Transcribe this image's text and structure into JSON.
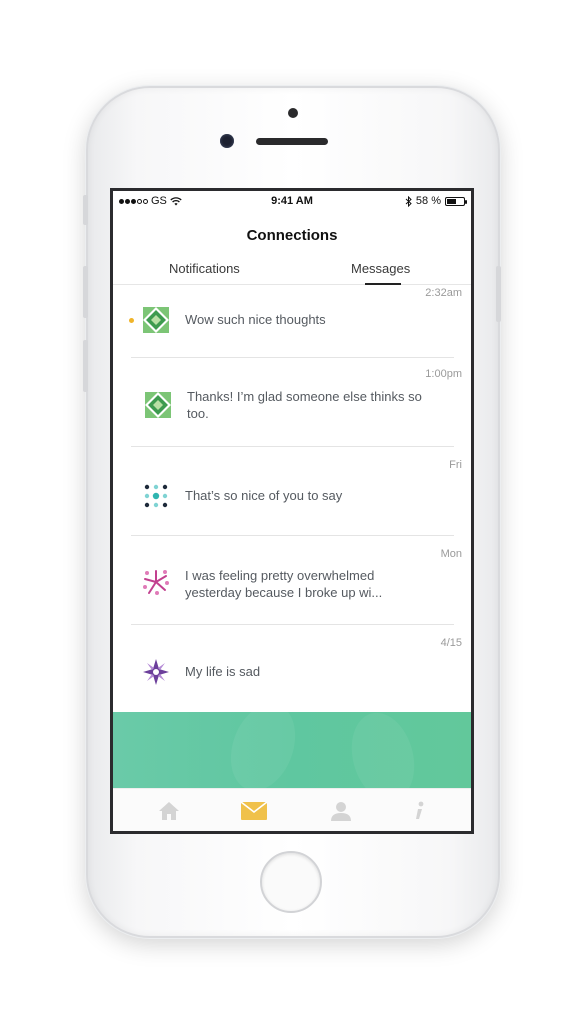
{
  "status_bar": {
    "carrier": "GS",
    "time": "9:41 AM",
    "battery_percent": "58 %",
    "battery_level": 0.58
  },
  "header": {
    "title": "Connections"
  },
  "tabs": [
    {
      "label": "Notifications",
      "active": false
    },
    {
      "label": "Messages",
      "active": true
    }
  ],
  "messages": [
    {
      "time": "2:32am",
      "text": "Wow such nice thoughts",
      "unread": true,
      "avatar_icon": "green-quilt-avatar-icon"
    },
    {
      "time": "1:00pm",
      "text": "Thanks! I’m glad someone else thinks so too.",
      "unread": false,
      "avatar_icon": "green-quilt-avatar-icon"
    },
    {
      "time": "Fri",
      "text": "That’s so nice of you to say",
      "unread": false,
      "avatar_icon": "dots-avatar-icon"
    },
    {
      "time": "Mon",
      "text": "I was feeling pretty overwhelmed yesterday because I broke up wi...",
      "unread": false,
      "avatar_icon": "pink-burst-avatar-icon"
    },
    {
      "time": "4/15",
      "text": "My life is sad",
      "unread": false,
      "avatar_icon": "purple-star-avatar-icon"
    }
  ],
  "bottom_tabs": [
    {
      "icon": "home-icon",
      "active": false
    },
    {
      "icon": "mail-icon",
      "active": true
    },
    {
      "icon": "profile-icon",
      "active": false
    },
    {
      "icon": "info-icon",
      "active": false
    }
  ],
  "colors": {
    "accent_yellow": "#f0c14b",
    "banner_green": "#5fc7a0",
    "unread_dot": "#f0b429",
    "inactive_icon": "#d4d4d4"
  }
}
